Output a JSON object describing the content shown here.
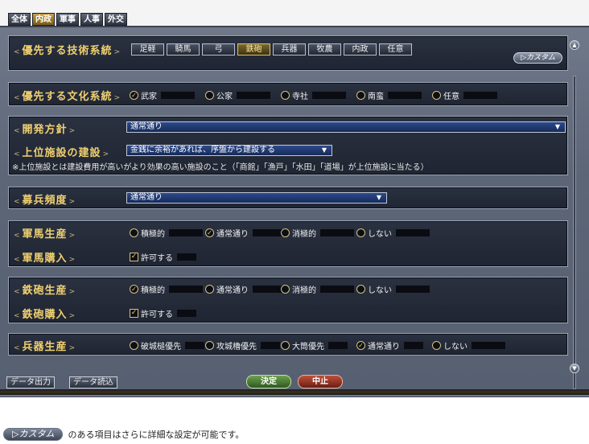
{
  "tabs": [
    "全体",
    "内政",
    "軍事",
    "人事",
    "外交"
  ],
  "active_tab": 1,
  "tech": {
    "label": "優先する技術系統",
    "options": [
      "足軽",
      "騎馬",
      "弓",
      "鉄砲",
      "兵器",
      "牧農",
      "内政",
      "任意"
    ],
    "selected": 3,
    "custom": "▷カスタム"
  },
  "culture": {
    "label": "優先する文化系統",
    "options": [
      "武家",
      "公家",
      "寺社",
      "南蛮",
      "任意"
    ],
    "checked": 0
  },
  "dev": {
    "label": "開発方針",
    "value": "通常通り"
  },
  "upper": {
    "label": "上位施設の建設",
    "value": "金銭に余裕があれば、序盤から建設する",
    "note": "※上位施設とは建設費用が高いがより効果の高い施設のこと（「商館」「漁戸」「水田」「道場」が上位施設に当たる）"
  },
  "recruit": {
    "label": "募兵頻度",
    "value": "通常通り"
  },
  "horse_prod": {
    "label": "軍馬生産",
    "options": [
      "積極的",
      "通常通り",
      "消極的",
      "しない"
    ],
    "checked": 1
  },
  "horse_buy": {
    "label": "軍馬購入",
    "check_label": "許可する"
  },
  "gun_prod": {
    "label": "鉄砲生産",
    "options": [
      "積極的",
      "通常通り",
      "消極的",
      "しない"
    ],
    "checked": 0
  },
  "gun_buy": {
    "label": "鉄砲購入",
    "check_label": "許可する"
  },
  "weapon_prod": {
    "label": "兵器生産",
    "options": [
      "破城槌優先",
      "攻城櫓優先",
      "大筒優先",
      "通常通り",
      "しない"
    ],
    "checked": 3
  },
  "footer": {
    "export": "データ出力",
    "import": "データ読込",
    "ok": "決定",
    "cancel": "中止"
  },
  "caption": {
    "button": "▷カスタム",
    "text": "のある項目はさらに詳細な設定が可能です。"
  }
}
